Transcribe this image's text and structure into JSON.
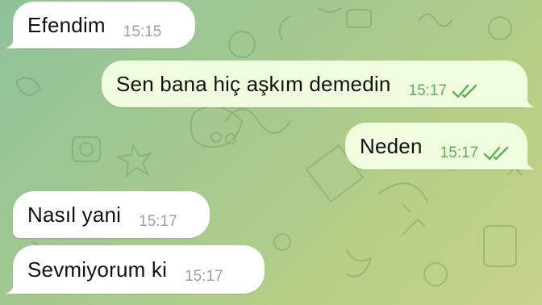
{
  "chat": {
    "messages": [
      {
        "text": "Efendim",
        "time": "15:15",
        "direction": "incoming"
      },
      {
        "text": "Sen bana hiç aşkım demedin",
        "time": "15:17",
        "direction": "outgoing",
        "status": "read-double-check-icon"
      },
      {
        "text": "Neden",
        "time": "15:17",
        "direction": "outgoing",
        "status": "read-double-check-icon"
      },
      {
        "text": "Nasıl yani",
        "time": "15:17",
        "direction": "incoming"
      },
      {
        "text": "Sevmiyorum ki",
        "time": "15:17",
        "direction": "incoming"
      }
    ]
  },
  "colors": {
    "incoming_bubble": "#ffffff",
    "outgoing_bubble": "#effdde",
    "outgoing_time": "#5fae5c",
    "incoming_time": "#9aa0a6",
    "wallpaper_start": "#8fc29a",
    "wallpaper_end": "#c6d489"
  }
}
